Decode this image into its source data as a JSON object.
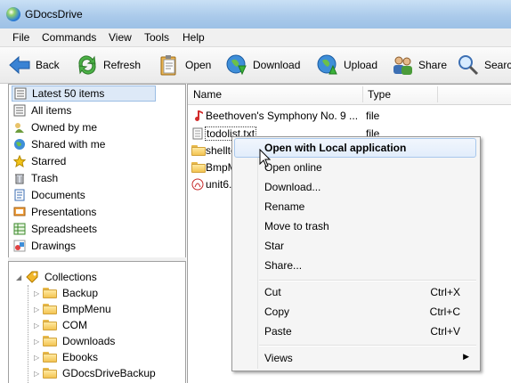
{
  "window": {
    "title": "GDocsDrive"
  },
  "menu": [
    "File",
    "Commands",
    "View",
    "Tools",
    "Help"
  ],
  "toolbar": {
    "back": "Back",
    "refresh": "Refresh",
    "open": "Open",
    "download": "Download",
    "upload": "Upload",
    "share": "Share",
    "search": "Search"
  },
  "nav": [
    {
      "label": "Latest 50 items",
      "icon": "latest-icon",
      "selected": true
    },
    {
      "label": "All items",
      "icon": "list-icon"
    },
    {
      "label": "Owned by me",
      "icon": "owner-icon"
    },
    {
      "label": "Shared with me",
      "icon": "shared-icon"
    },
    {
      "label": "Starred",
      "icon": "star-icon"
    },
    {
      "label": "Trash",
      "icon": "trash-icon"
    },
    {
      "label": "Documents",
      "icon": "document-icon"
    },
    {
      "label": "Presentations",
      "icon": "presentation-icon"
    },
    {
      "label": "Spreadsheets",
      "icon": "spreadsheet-icon"
    },
    {
      "label": "Drawings",
      "icon": "drawing-icon"
    }
  ],
  "tree": {
    "root": "Collections",
    "children": [
      "Backup",
      "BmpMenu",
      "COM",
      "Downloads",
      "Ebooks",
      "GDocsDriveBackup"
    ]
  },
  "files": {
    "columns": {
      "name": "Name",
      "type": "Type"
    },
    "rows": [
      {
        "name": "Beethoven's Symphony No. 9 ...",
        "type": "file",
        "icon": "music-icon"
      },
      {
        "name": "todolist.txt",
        "type": "file",
        "icon": "text-file-icon"
      },
      {
        "name": "shellte",
        "type": "",
        "icon": "folder-icon"
      },
      {
        "name": "BmpM",
        "type": "",
        "icon": "folder-icon"
      },
      {
        "name": "unit6.",
        "type": "",
        "icon": "pdf-icon"
      }
    ]
  },
  "context_menu": {
    "items": [
      {
        "label": "Open with Local application",
        "shortcut": "",
        "highlighted": true
      },
      {
        "label": "Open online",
        "shortcut": ""
      },
      {
        "label": "Download...",
        "shortcut": ""
      },
      {
        "label": "Rename",
        "shortcut": ""
      },
      {
        "label": "Move to trash",
        "shortcut": ""
      },
      {
        "label": "Star",
        "shortcut": ""
      },
      {
        "label": "Share...",
        "shortcut": ""
      },
      {
        "label": "Cut",
        "shortcut": "Ctrl+X"
      },
      {
        "label": "Copy",
        "shortcut": "Ctrl+C"
      },
      {
        "label": "Paste",
        "shortcut": "Ctrl+V"
      },
      {
        "label": "Views",
        "shortcut": "",
        "submenu": true
      }
    ]
  },
  "colors": {
    "selection": "#dde9f7",
    "titlebar": "#a9c9ea"
  }
}
